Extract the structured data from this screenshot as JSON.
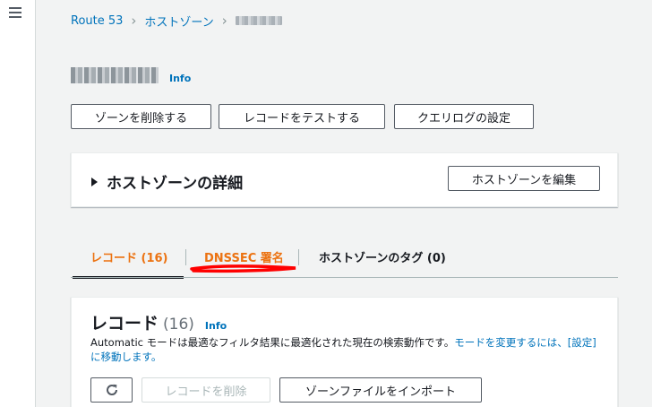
{
  "breadcrumb": {
    "items": [
      "Route 53",
      "ホストゾーン"
    ]
  },
  "header": {
    "info_label": "Info"
  },
  "actions": {
    "delete_zone": "ゾーンを削除する",
    "test_record": "レコードをテストする",
    "query_logging": "クエリログの設定"
  },
  "details": {
    "title": "ホストゾーンの詳細",
    "edit_label": "ホストゾーンを編集"
  },
  "tabs": [
    {
      "label": "レコード (16)",
      "active": true
    },
    {
      "label": "DNSSEC 署名",
      "active": false
    },
    {
      "label": "ホストゾーンのタグ (0)",
      "active": false
    }
  ],
  "records": {
    "title": "レコード",
    "count": "(16)",
    "info_label": "Info",
    "desc_text": "Automatic モードは最適なフィルタ結果に最適化された現在の検索動作です。",
    "desc_link": "モードを変更するには、[設定] に移動します。",
    "delete_label": "レコードを削除",
    "import_label": "ゾーンファイルをインポート"
  },
  "colors": {
    "accent": "#ec7211",
    "link": "#0073bb",
    "annotation": "#ff0000"
  }
}
